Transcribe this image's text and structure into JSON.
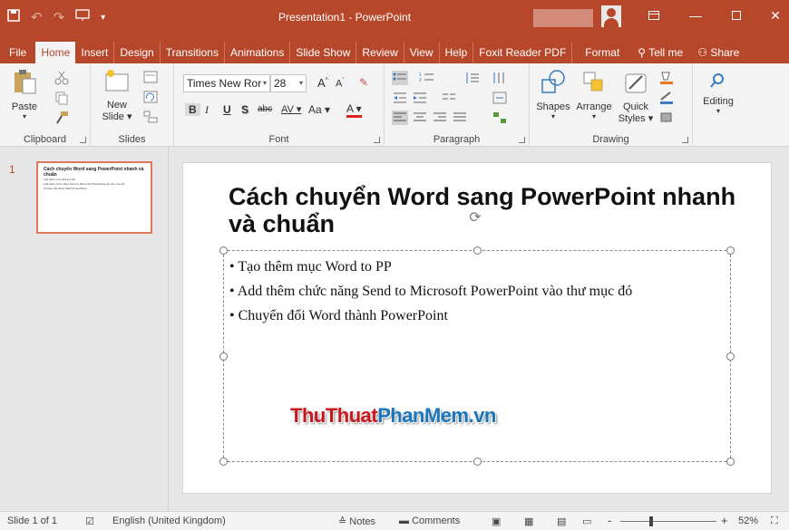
{
  "app": {
    "window_title": "Presentation1 - PowerPoint",
    "qat": {
      "save_icon": "save-icon",
      "undo_icon": "undo-icon",
      "redo_icon": "redo-icon",
      "start_slideshow_icon": "slideshow-icon",
      "customize_icon": "customize-qat-icon"
    },
    "window_controls": [
      "ribbon-display-icon",
      "minimize-icon",
      "restore-icon",
      "close-icon"
    ]
  },
  "tabs": [
    {
      "label": "File"
    },
    {
      "label": "Home",
      "active": true
    },
    {
      "label": "Insert"
    },
    {
      "label": "Design"
    },
    {
      "label": "Transitions"
    },
    {
      "label": "Animations"
    },
    {
      "label": "Slide Show"
    },
    {
      "label": "Review"
    },
    {
      "label": "View"
    },
    {
      "label": "Help"
    },
    {
      "label": "Foxit Reader PDF"
    },
    {
      "label": "Format"
    },
    {
      "label": "Tell me"
    },
    {
      "label": "Share"
    }
  ],
  "ribbon": {
    "clipboard": {
      "label": "Clipboard",
      "paste": "Paste"
    },
    "slides": {
      "label": "Slides",
      "new_slide_line1": "New",
      "new_slide_line2": "Slide"
    },
    "font": {
      "label": "Font",
      "font_name": "Times New Ror",
      "font_size": "28",
      "bold": "B",
      "italic": "I",
      "underline": "U",
      "shadow": "S",
      "strike": "abc",
      "spacing": "AV",
      "case": "Aa",
      "color": "A",
      "grow": "A",
      "shrink": "A"
    },
    "paragraph": {
      "label": "Paragraph"
    },
    "drawing": {
      "label": "Drawing",
      "shapes": "Shapes",
      "arrange": "Arrange",
      "quick_line1": "Quick",
      "quick_line2": "Styles"
    },
    "editing": {
      "label": "Editing"
    }
  },
  "thumbnails": [
    {
      "number": "1",
      "title": "Cách chuyển Word sang PowerPoint nhanh và chuẩn"
    }
  ],
  "slide": {
    "title": "Cách chuyển Word sang PowerPoint nhanh và chuẩn",
    "bullets": [
      "Tạo thêm mục Word to PP",
      "Add thêm chức năng Send to Microsoft PowerPoint vào thư mục đó",
      "Chuyển đổi Word thành PowerPoint"
    ],
    "watermark_part1": "ThuThuat",
    "watermark_part2": "PhanMem.vn"
  },
  "status": {
    "slide_count": "Slide 1 of 1",
    "language": "English (United Kingdom)",
    "notes": "Notes",
    "comments": "Comments",
    "zoom": "52%",
    "zoom_minus": "-",
    "zoom_plus": "+"
  },
  "colors": {
    "accent": "#b7472a",
    "thumb_border": "#e0795a"
  }
}
